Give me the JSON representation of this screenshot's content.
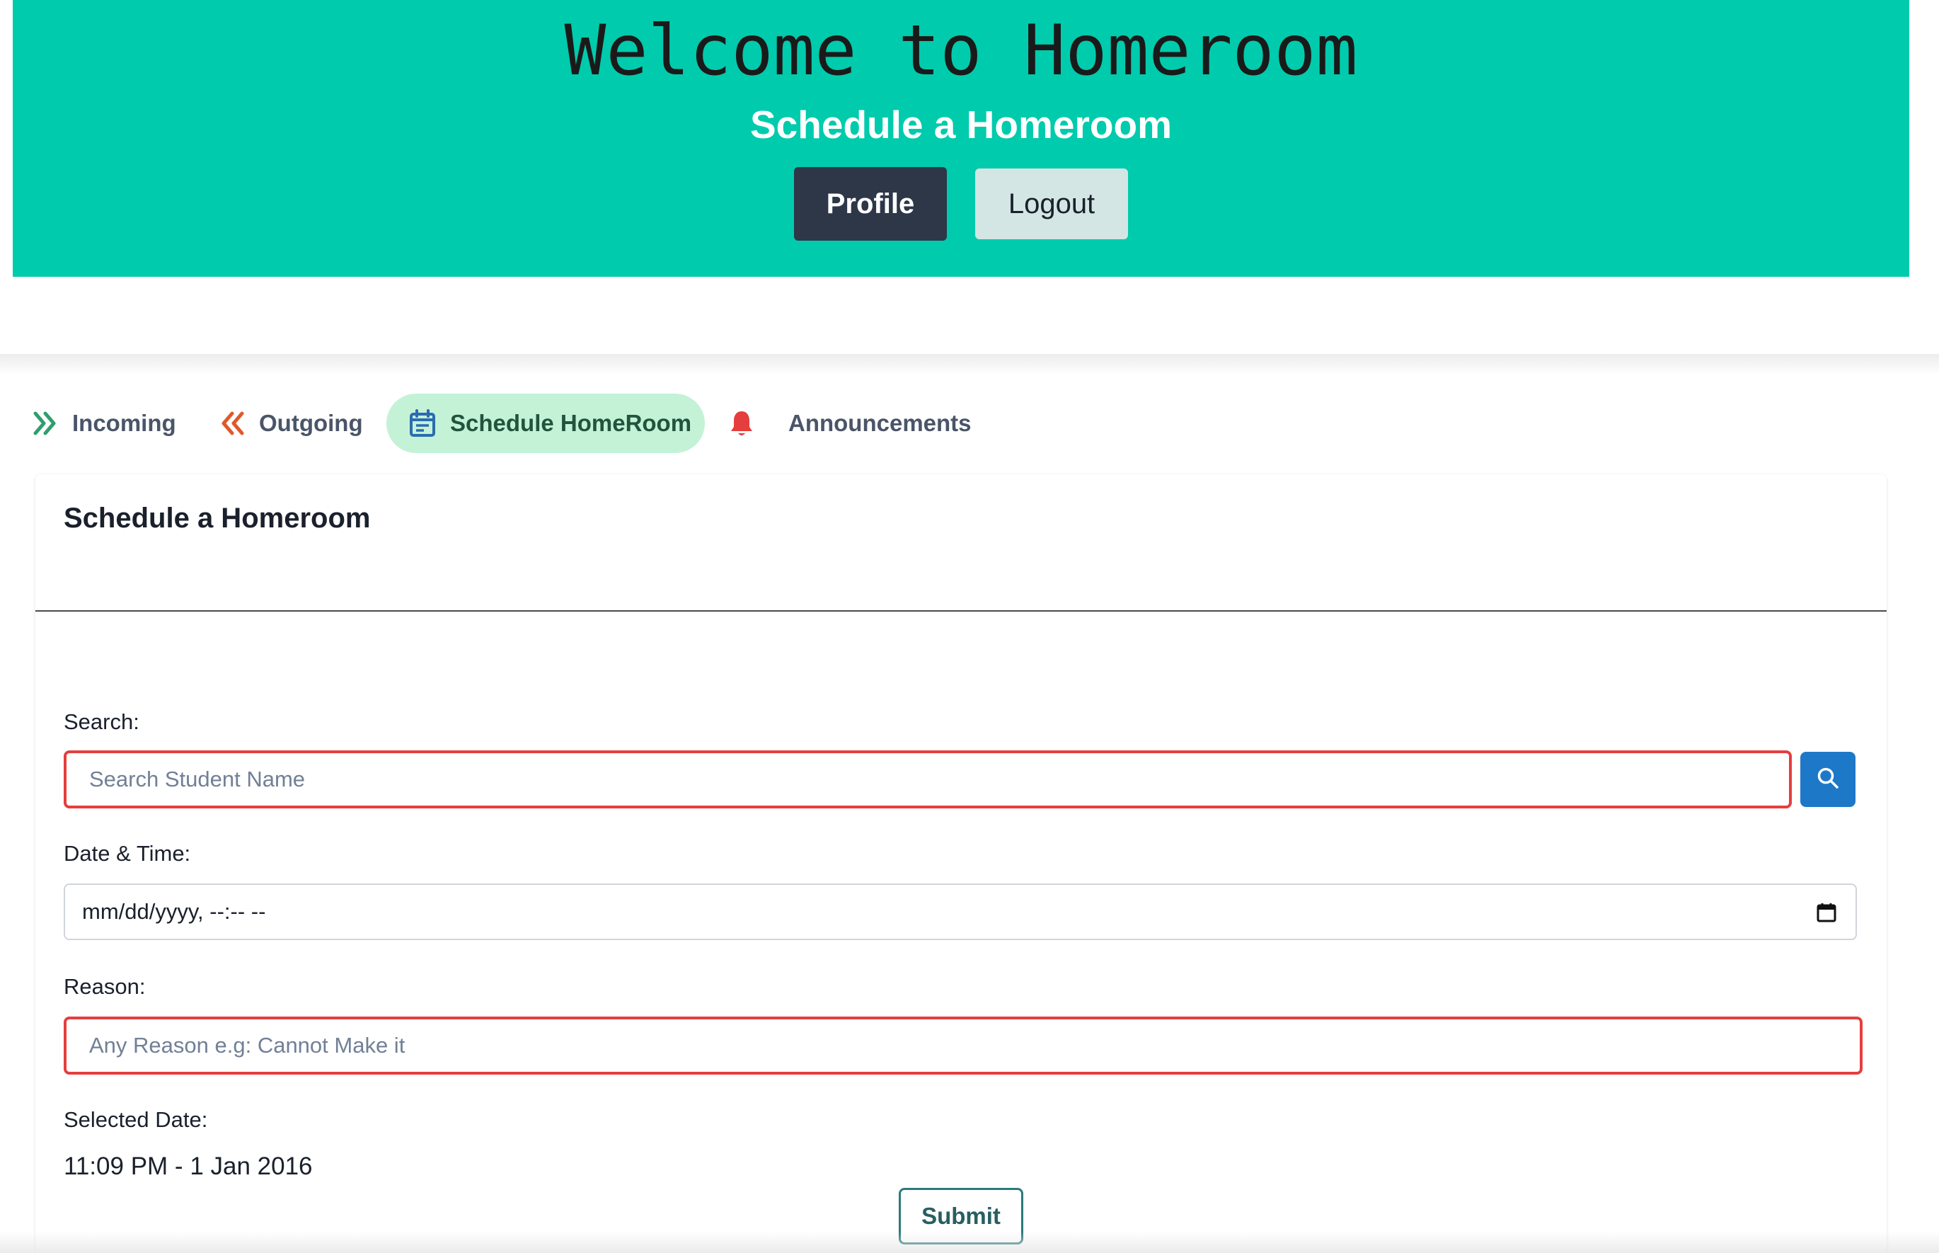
{
  "header": {
    "title": "Welcome to Homeroom",
    "subtitle": "Schedule a Homeroom",
    "profile_label": "Profile",
    "logout_label": "Logout"
  },
  "tabs": [
    {
      "label": "Incoming",
      "icon": "double-chevron-right-icon",
      "color": "#2f9e6e"
    },
    {
      "label": "Outgoing",
      "icon": "double-chevron-left-icon",
      "color": "#e0592a"
    },
    {
      "label": "Schedule HomeRoom",
      "icon": "calendar-icon",
      "color": "#2b6cb0",
      "active": true
    },
    {
      "label": "Announcements",
      "icon": "bell-icon",
      "color": "#e53e3e"
    }
  ],
  "card": {
    "title": "Schedule a Homeroom",
    "search": {
      "label": "Search:",
      "placeholder": "Search Student Name",
      "value": ""
    },
    "datetime": {
      "label": "Date & Time:",
      "value": "mm/dd/yyyy, --:-- --"
    },
    "reason": {
      "label": "Reason:",
      "placeholder": "Any Reason e.g: Cannot Make it",
      "value": ""
    },
    "selected": {
      "label": "Selected Date:",
      "value": "11:09 PM - 1 Jan 2016"
    },
    "submit_label": "Submit"
  },
  "colors": {
    "hero_bg": "#00cbad",
    "profile_btn": "#2d3748",
    "logout_btn": "#d3e6e3",
    "active_tab_bg": "#c4f2d6",
    "error_border": "#e53e3e",
    "search_btn": "#1e78c8",
    "submit_border": "#2c7a7b"
  }
}
